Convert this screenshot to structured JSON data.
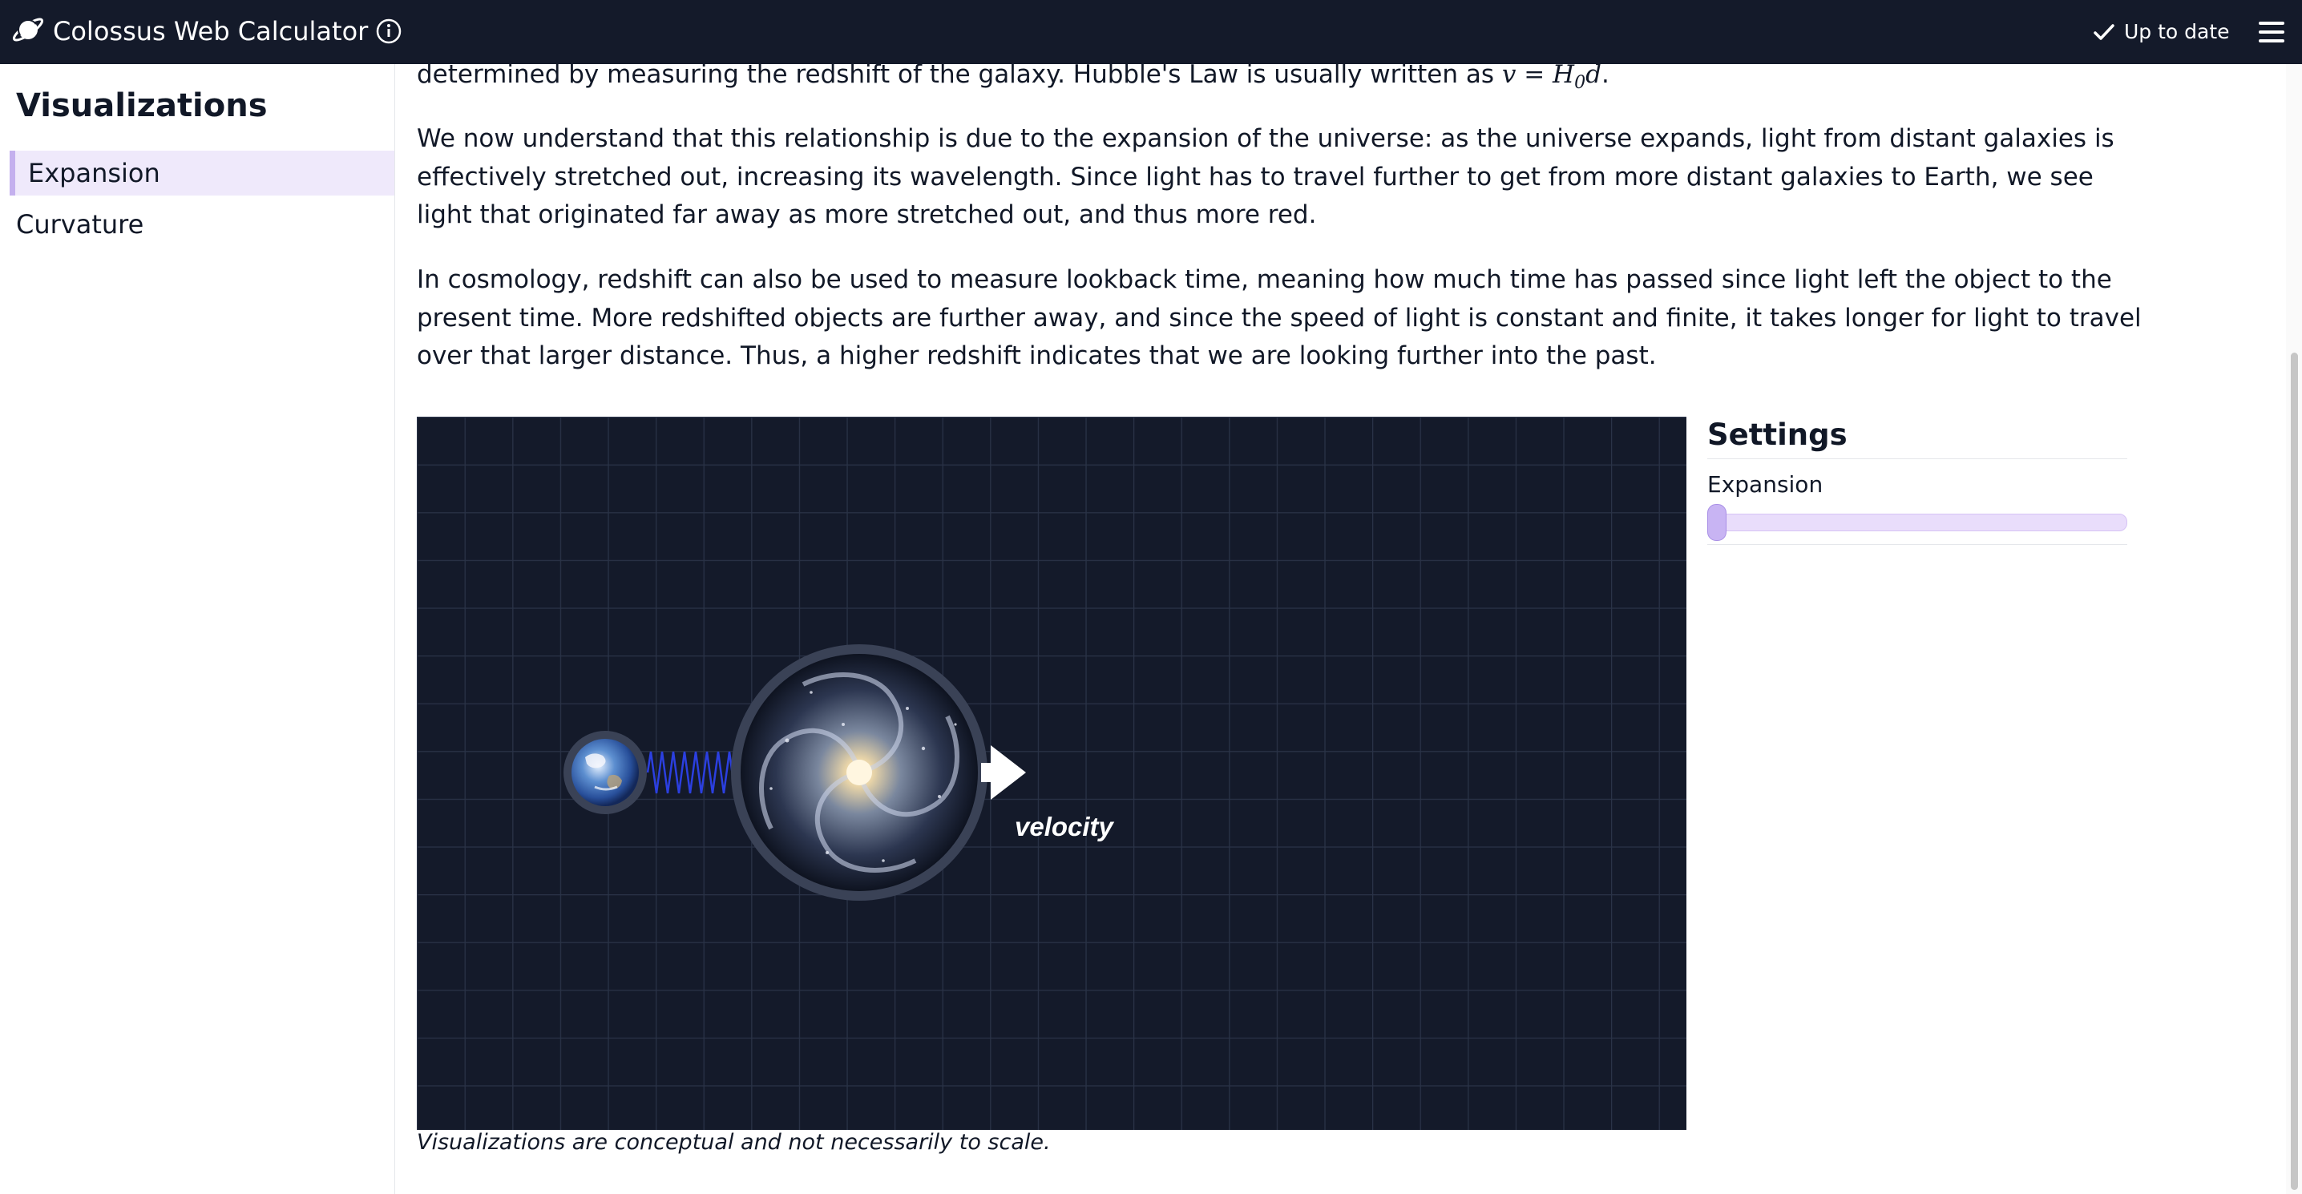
{
  "app": {
    "title": "Colossus Web Calculator",
    "status": "Up to date",
    "icons": {
      "logo": "planet-icon",
      "info": "info-icon",
      "status": "checkmark-icon",
      "menu": "hamburger-menu-icon"
    }
  },
  "sidebar": {
    "heading": "Visualizations",
    "items": [
      {
        "label": "Expansion",
        "active": true
      },
      {
        "label": "Curvature",
        "active": false
      }
    ]
  },
  "content": {
    "para1_text": "determined by measuring the redshift of the galaxy. Hubble's Law is usually written as ",
    "para1_formula": "v = H",
    "para1_formula_sub": "0",
    "para1_formula_tail": "d",
    "para1_end": ".",
    "para2": "We now understand that this relationship is due to the expansion of the universe: as the universe expands, light from distant galaxies is effectively stretched out, increasing its wavelength. Since light has to travel further to get from more distant galaxies to Earth, we see light that originated far away as more stretched out, and thus more red.",
    "para3": "In cosmology, redshift can also be used to measure lookback time, meaning how much time has passed since light left the object to the present time. More redshifted objects are further away, and since the speed of light is constant and finite, it takes longer for light to travel over that larger distance. Thus, a higher redshift indicates that we are looking further into the past."
  },
  "visualization": {
    "velocity_label": "velocity",
    "caption": "Visualizations are conceptual and not necessarily to scale.",
    "background_color": "#141a2a",
    "wave_color": "#2b3fe0"
  },
  "settings": {
    "heading": "Settings",
    "slider_label": "Expansion",
    "slider_value": 0
  },
  "colors": {
    "topbar": "#141a2a",
    "accent": "#c4b0ee",
    "active_bg": "#efe9fb"
  }
}
